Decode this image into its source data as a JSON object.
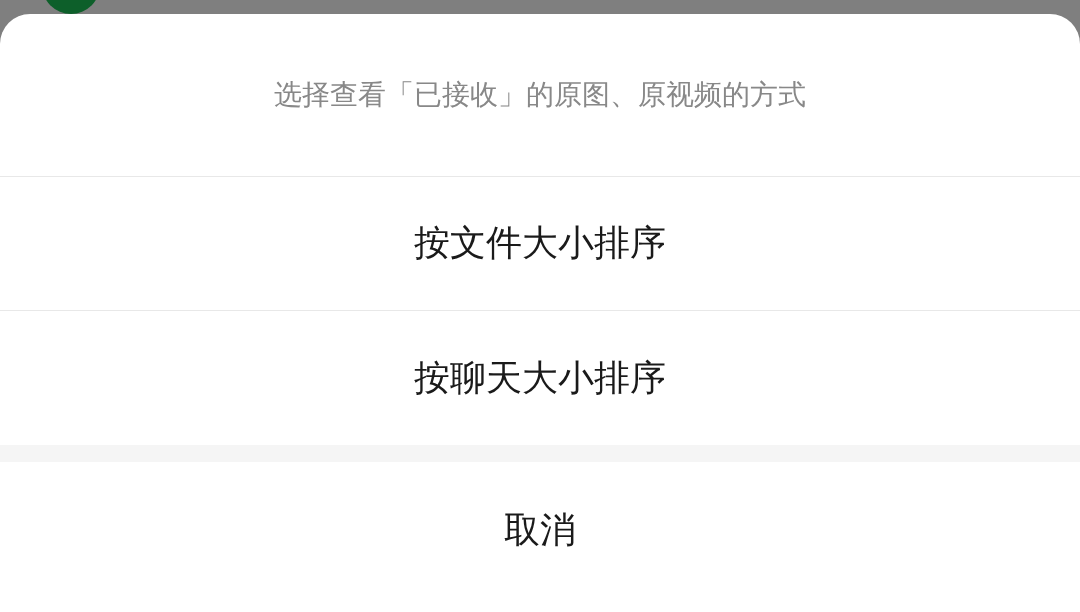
{
  "sheet": {
    "title": "选择查看「已接收」的原图、原视频的方式",
    "options": [
      "按文件大小排序",
      "按聊天大小排序"
    ],
    "cancel": "取消"
  }
}
